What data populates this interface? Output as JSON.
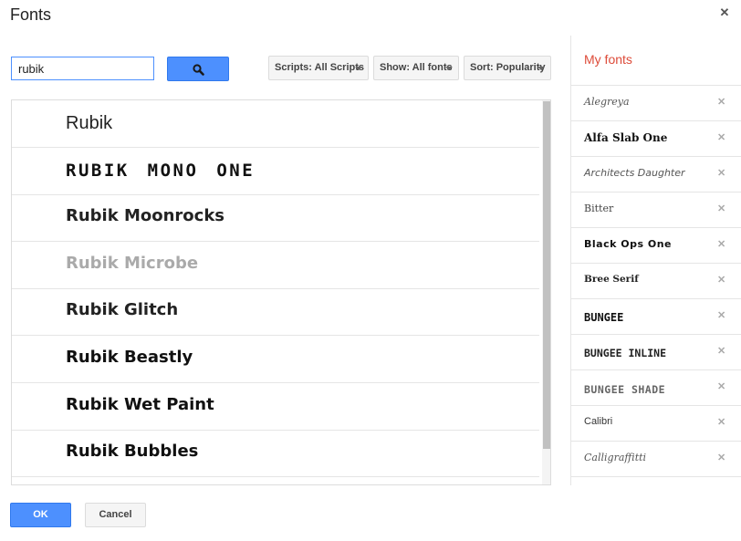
{
  "dialog": {
    "title": "Fonts",
    "close_icon": "close-icon"
  },
  "search": {
    "value": "rubik",
    "button_icon": "search-icon"
  },
  "filters": {
    "scripts_label": "Scripts: All Scripts",
    "show_label": "Show: All fonts",
    "sort_label": "Sort: Popularity"
  },
  "results": {
    "items": [
      {
        "label": "Rubik"
      },
      {
        "label": "RUBIK MONO ONE"
      },
      {
        "label": "Rubik Moonrocks"
      },
      {
        "label": "Rubik Microbe"
      },
      {
        "label": "Rubik Glitch"
      },
      {
        "label": "Rubik Beastly"
      },
      {
        "label": "Rubik Wet Paint"
      },
      {
        "label": "Rubik Bubbles"
      }
    ]
  },
  "my_fonts": {
    "title": "My fonts",
    "remove_icon": "close-icon",
    "items": [
      {
        "label": "Alegreya"
      },
      {
        "label": "Alfa Slab One"
      },
      {
        "label": "Architects Daughter"
      },
      {
        "label": "Bitter"
      },
      {
        "label": "Black Ops One"
      },
      {
        "label": "Bree Serif"
      },
      {
        "label": "BUNGEE"
      },
      {
        "label": "BUNGEE INLINE"
      },
      {
        "label": "BUNGEE SHADE"
      },
      {
        "label": "Calibri"
      },
      {
        "label": "Calligraffitti"
      }
    ]
  },
  "footer": {
    "ok_label": "OK",
    "cancel_label": "Cancel"
  },
  "colors": {
    "accent_blue": "#4d90fe",
    "my_fonts_title": "#dd4b39"
  }
}
